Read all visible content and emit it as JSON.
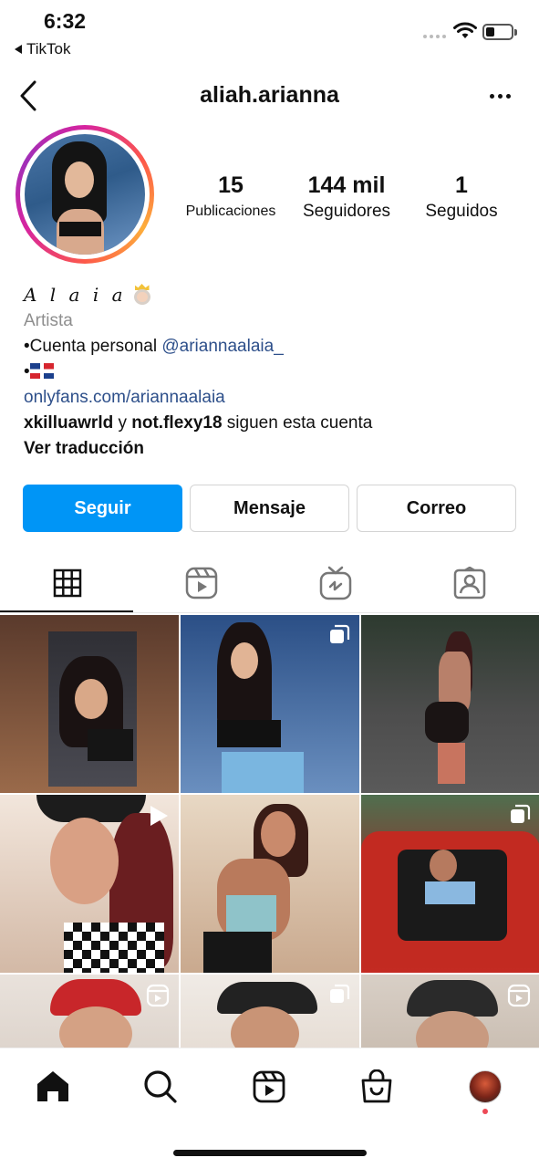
{
  "status_bar": {
    "time": "6:32",
    "back_app": "TikTok"
  },
  "header": {
    "username": "aliah.arianna"
  },
  "stats": {
    "posts_count": "15",
    "posts_label": "Publicaciones",
    "followers_count": "144 mil",
    "followers_label": "Seguidores",
    "following_count": "1",
    "following_label": "Seguidos"
  },
  "bio": {
    "name": "A l a i a",
    "category": "Artista",
    "line1_prefix": "•Cuenta personal ",
    "line1_mention": "@ariannaalaia_",
    "line2_prefix": "•",
    "website": "onlyfans.com/ariannaalaia",
    "followed_user1": "xkilluawrld",
    "followed_join": " y ",
    "followed_user2": "not.flexy18",
    "followed_suffix": " siguen esta cuenta",
    "translate": "Ver traducción"
  },
  "buttons": {
    "follow": "Seguir",
    "message": "Mensaje",
    "email": "Correo"
  },
  "colors": {
    "accent": "#0095f6",
    "link": "#2d4f8a",
    "muted": "#8e8e8e",
    "notification": "#ed4956"
  },
  "tabs": [
    {
      "icon": "grid-icon",
      "active": true
    },
    {
      "icon": "reels-icon",
      "active": false
    },
    {
      "icon": "igtv-icon",
      "active": false
    },
    {
      "icon": "tagged-icon",
      "active": false
    }
  ],
  "posts": [
    {
      "badge": "none"
    },
    {
      "badge": "carousel-icon"
    },
    {
      "badge": "none"
    },
    {
      "badge": "play-icon"
    },
    {
      "badge": "none"
    },
    {
      "badge": "carousel-icon"
    },
    {
      "badge": "reels-icon"
    },
    {
      "badge": "carousel-icon"
    },
    {
      "badge": "reels-icon"
    }
  ],
  "bottom_nav": [
    "home-icon",
    "search-icon",
    "reels-icon",
    "shop-icon",
    "profile-avatar"
  ]
}
